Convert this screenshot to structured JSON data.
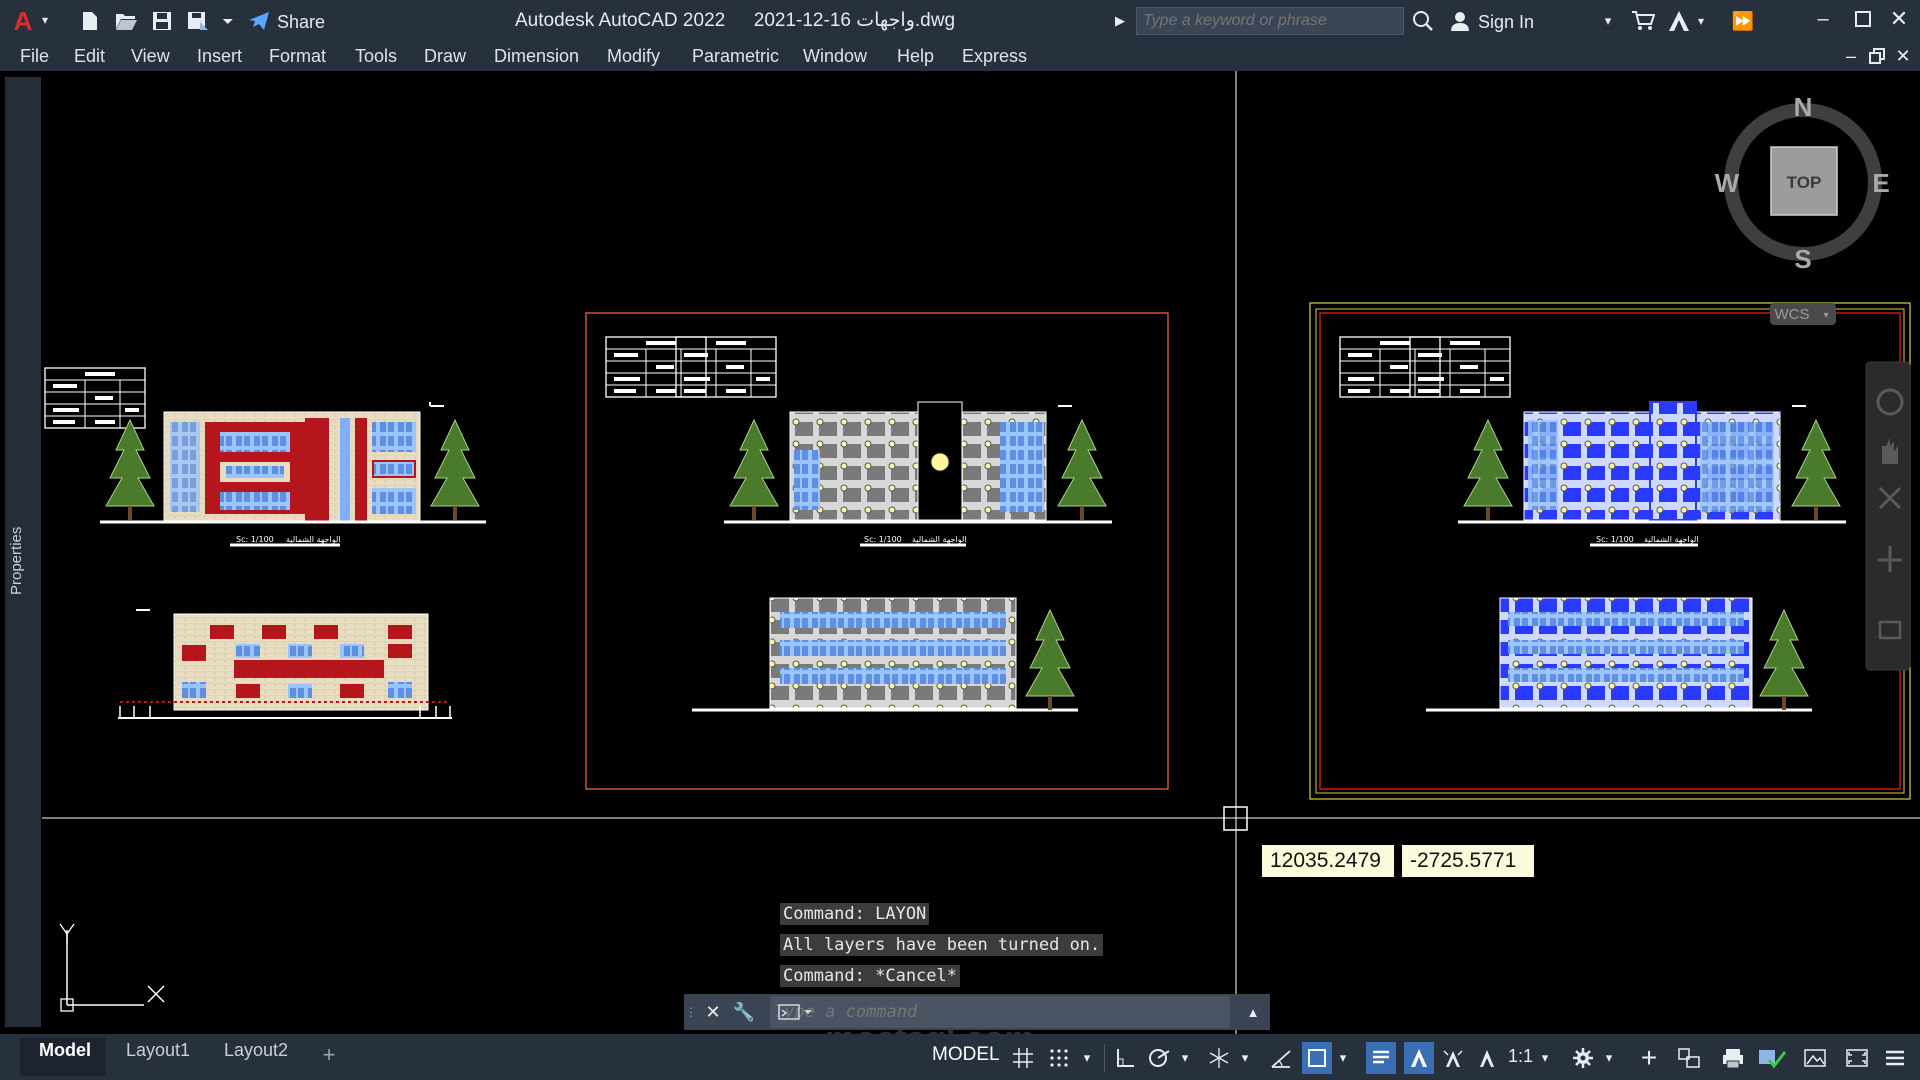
{
  "window": {
    "app_title": "Autodesk AutoCAD 2022",
    "file_name": "2021-12-16 واجهات.dwg",
    "search_placeholder": "Type a keyword or phrase",
    "share_label": "Share",
    "sign_in_label": "Sign In"
  },
  "menu": [
    "File",
    "Edit",
    "View",
    "Insert",
    "Format",
    "Tools",
    "Draw",
    "Dimension",
    "Modify",
    "Parametric",
    "Window",
    "Help",
    "Express"
  ],
  "properties_label": "Properties",
  "viewcube": {
    "top_label": "TOP",
    "north": "N",
    "south": "S",
    "east": "E",
    "west": "W",
    "wcs_label": "WCS"
  },
  "drawings": {
    "scale_label": "Sc: 1/100",
    "caption": "الواجهة الشمالية"
  },
  "coordinates": {
    "x": "12035.2479",
    "y": "-2725.5771"
  },
  "ucs": {
    "x": "X",
    "y": "Y"
  },
  "command_history": [
    "Command: LAYON",
    "All layers have been turned on.",
    "Command: *Cancel*"
  ],
  "command_placeholder": "Type a command",
  "tabs": [
    "Model",
    "Layout1",
    "Layout2"
  ],
  "status": {
    "model_label": "MODEL",
    "scale_label": "1:1"
  },
  "watermark": "mostaql.com",
  "colors": {
    "chrome": "#27303d",
    "canvas": "#000000",
    "sheet_border": "#ff6a33",
    "tooltip": "#fbfbdc"
  }
}
